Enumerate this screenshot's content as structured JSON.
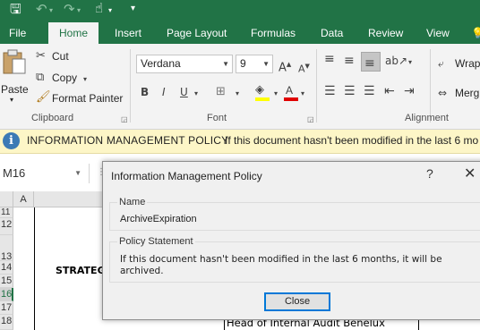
{
  "quick_access": {
    "save_icon": "save-icon",
    "undo_icon": "undo-icon",
    "redo_icon": "redo-icon",
    "touch_icon": "touch-mode-icon",
    "customize_icon": "customize-qat-icon"
  },
  "tabs": [
    "File",
    "Home",
    "Insert",
    "Page Layout",
    "Formulas",
    "Data",
    "Review",
    "View"
  ],
  "clipboard": {
    "paste": "Paste",
    "cut": "Cut",
    "copy": "Copy",
    "format_painter": "Format Painter",
    "group_label": "Clipboard"
  },
  "font": {
    "name": "Verdana",
    "size": "9",
    "bold": "B",
    "italic": "I",
    "underline": "U",
    "grow": "A",
    "shrink": "A",
    "font_color_letter": "A",
    "group_label": "Font"
  },
  "alignment": {
    "wrap": "Wrap",
    "merge": "Merg",
    "group_label": "Alignment"
  },
  "info_bar": {
    "title": "INFORMATION MANAGEMENT POLICY",
    "message": "If this document hasn't been modified in the last 6 mo"
  },
  "name_box": "M16",
  "columns": [
    "A"
  ],
  "rows": [
    "11",
    "12",
    "13",
    "14",
    "15",
    "16",
    "17",
    "18"
  ],
  "selected_row": "16",
  "cells": {
    "strategy_fragment": "STRATEG",
    "head_audit": "Head of Internal Audit Benelux"
  },
  "dialog": {
    "title": "Information Management Policy",
    "help": "?",
    "close_x": "✕",
    "name_label": "Name",
    "name_value": "ArchiveExpiration",
    "policy_label": "Policy Statement",
    "policy_text": "If this document hasn't been modified in the last 6 months, it will be archived.",
    "close_button": "Close"
  },
  "colors": {
    "excel_green": "#217346",
    "ribbon_bg": "#f3f3f3",
    "info_bar_bg": "#fdf6c7",
    "dialog_bg": "#f0f0f0",
    "focus_blue": "#0078d7"
  }
}
